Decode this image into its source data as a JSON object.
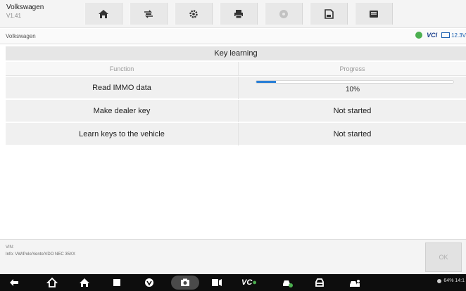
{
  "app": {
    "name": "Volkswagen",
    "version": "V1.41"
  },
  "toolbar": {
    "buttons": [
      {
        "icon": "home-icon"
      },
      {
        "icon": "vehicle-swap-icon"
      },
      {
        "icon": "settings-icon"
      },
      {
        "icon": "print-icon"
      },
      {
        "icon": "help-icon"
      },
      {
        "icon": "save-icon"
      },
      {
        "icon": "data-logging-icon"
      }
    ]
  },
  "pathbar": {
    "path": "Volkswagen",
    "vci_label": "VCI",
    "vci_suffix": "",
    "voltage": "12.3V"
  },
  "table": {
    "title": "Key learning",
    "headers": {
      "function": "Function",
      "progress": "Progress"
    },
    "rows": [
      {
        "function": "Read IMMO data",
        "progress": 0.1,
        "status": "10%"
      },
      {
        "function": "Make dealer key",
        "status": "Not started"
      },
      {
        "function": "Learn keys to the vehicle",
        "status": "Not started"
      }
    ]
  },
  "footer": {
    "vin_label": "VIN:",
    "info": "Info: VW/Polo/Vento/VDO NEC 35XX",
    "ok_label": "OK"
  },
  "system": {
    "status": "64% 14:1"
  },
  "colors": {
    "accent": "#2a7fd6",
    "vci_green": "#4caf50",
    "navbar": "#0d0d0d"
  }
}
